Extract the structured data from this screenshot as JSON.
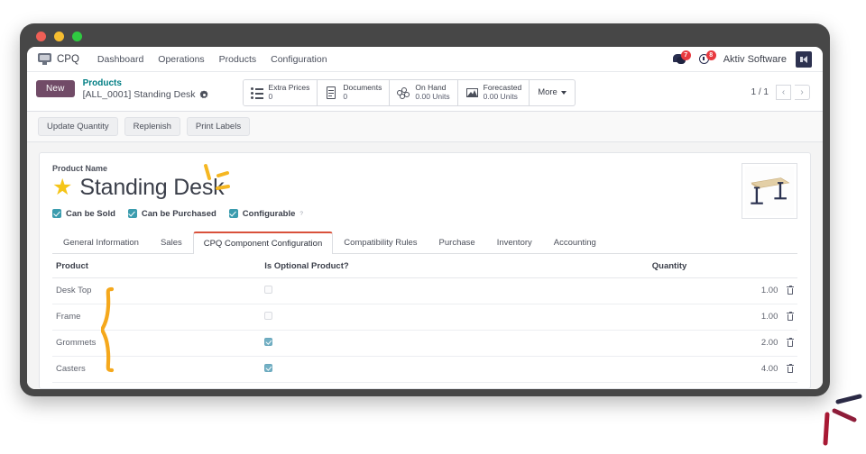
{
  "window": {
    "traffic_lights": [
      "close",
      "minimize",
      "maximize"
    ]
  },
  "navbar": {
    "brand": "CPQ",
    "brand_icon": "monitor-icon",
    "menu_items": [
      {
        "label": "Dashboard"
      },
      {
        "label": "Operations"
      },
      {
        "label": "Products"
      },
      {
        "label": "Configuration"
      }
    ],
    "messages_icon": "speech-bubble-icon",
    "messages_badge": "7",
    "activities_icon": "clock-icon",
    "activities_badge": "8",
    "company": "Aktiv Software",
    "avatar_icon": "megaphone-icon"
  },
  "control_panel": {
    "new_button": "New",
    "breadcrumb_parent": "Products",
    "breadcrumb_current": "[ALL_0001] Standing Desk",
    "settings_icon": "gear-icon",
    "smart_buttons": [
      {
        "icon": "list-icon",
        "label": "Extra Prices",
        "value": "0"
      },
      {
        "icon": "document-icon",
        "label": "Documents",
        "value": "0"
      },
      {
        "icon": "on-hand-icon",
        "label": "On Hand",
        "value": "0.00 Units"
      },
      {
        "icon": "forecast-icon",
        "label": "Forecasted",
        "value": "0.00 Units"
      }
    ],
    "more_button": "More",
    "pager": {
      "text": "1 / 1",
      "prev_icon": "chevron-left-icon",
      "next_icon": "chevron-right-icon"
    }
  },
  "action_buttons": [
    {
      "label": "Update Quantity"
    },
    {
      "label": "Replenish"
    },
    {
      "label": "Print Labels"
    }
  ],
  "form": {
    "product_name_label": "Product Name",
    "product_name": "Standing Desk",
    "favorite_icon": "star-icon",
    "product_image_alt": "standing-desk-photo",
    "checkboxes": [
      {
        "label": "Can be Sold",
        "checked": true,
        "superscript": ""
      },
      {
        "label": "Can be Purchased",
        "checked": true,
        "superscript": ""
      },
      {
        "label": "Configurable",
        "checked": true,
        "superscript": "?"
      }
    ]
  },
  "tabs": [
    {
      "label": "General Information",
      "active": false
    },
    {
      "label": "Sales",
      "active": false
    },
    {
      "label": "CPQ Component Configuration",
      "active": true
    },
    {
      "label": "Compatibility Rules",
      "active": false
    },
    {
      "label": "Purchase",
      "active": false
    },
    {
      "label": "Inventory",
      "active": false
    },
    {
      "label": "Accounting",
      "active": false
    }
  ],
  "component_table": {
    "columns": [
      "Product",
      "Is Optional Product?",
      "Quantity"
    ],
    "rows": [
      {
        "product": "Desk Top",
        "is_optional": false,
        "quantity": "1.00",
        "delete_icon": "trash-icon"
      },
      {
        "product": "Frame",
        "is_optional": false,
        "quantity": "1.00",
        "delete_icon": "trash-icon"
      },
      {
        "product": "Grommets",
        "is_optional": true,
        "quantity": "2.00",
        "delete_icon": "trash-icon"
      },
      {
        "product": "Casters",
        "is_optional": true,
        "quantity": "4.00",
        "delete_icon": "trash-icon"
      }
    ]
  },
  "annotations": [
    {
      "name": "sparkle-annotation",
      "color": "#f5b722"
    },
    {
      "name": "curly-brace-annotation",
      "color": "#f5a81c"
    },
    {
      "name": "burst-annotation",
      "color": "#8e1d3a"
    }
  ],
  "colors": {
    "brand_purple": "#714b67",
    "link_teal": "#017e84",
    "active_tab_border": "#d9513b",
    "checkbox_teal": "#3b9cae",
    "badge_red": "#e8393f",
    "star_gold": "#f5c518"
  }
}
